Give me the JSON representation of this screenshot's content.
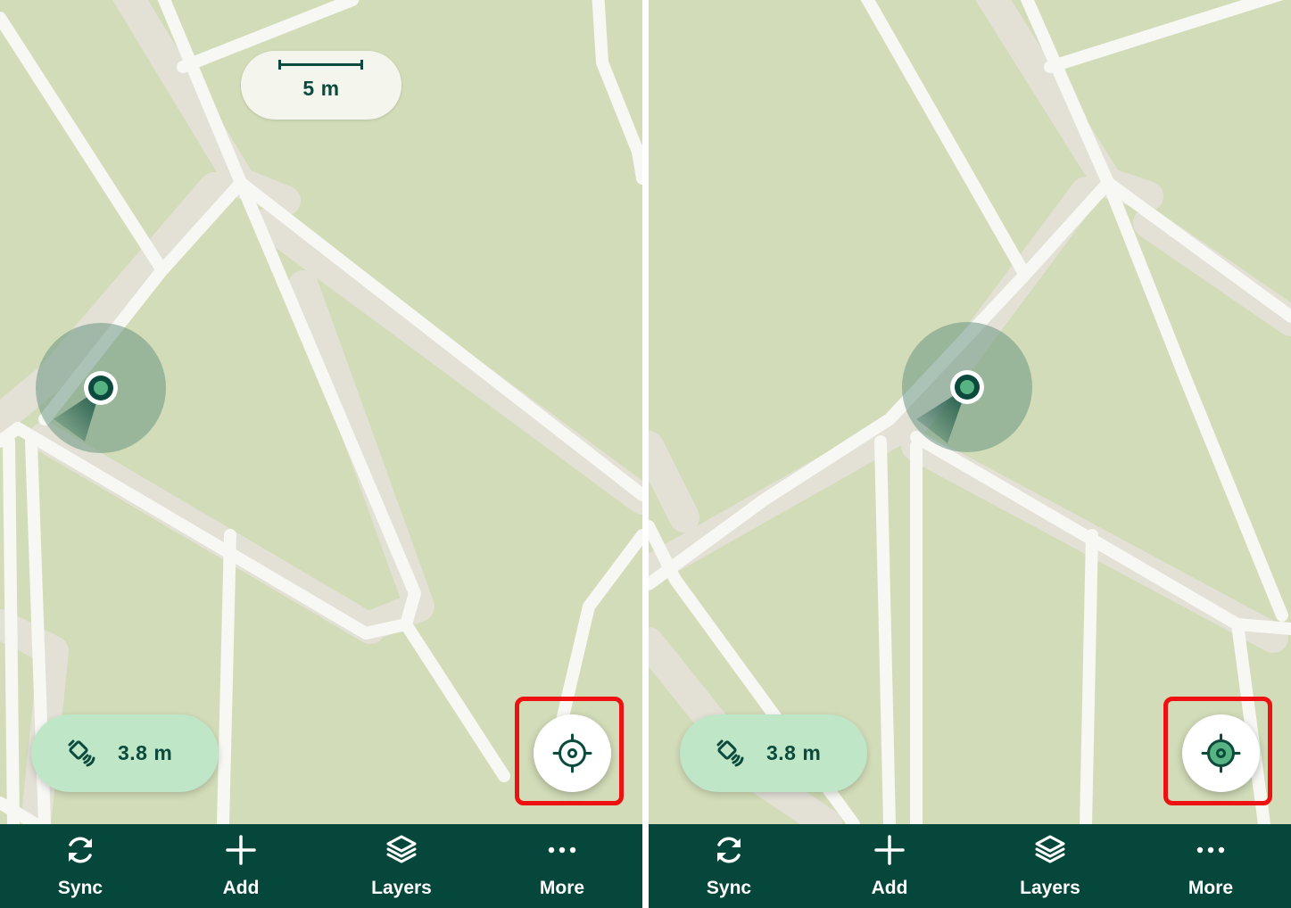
{
  "screens": [
    {
      "id": "left",
      "scale_label": "5 m",
      "accuracy_label": "3.8 m",
      "locate_button_state": "inactive",
      "locate_icon_color": "#0b4a3c",
      "locate_icon_fill": "#ffffff",
      "nav": [
        {
          "label": "Sync",
          "icon": "sync-icon"
        },
        {
          "label": "Add",
          "icon": "plus-icon"
        },
        {
          "label": "Layers",
          "icon": "layers-icon"
        },
        {
          "label": "More",
          "icon": "more-icon"
        }
      ]
    },
    {
      "id": "right",
      "accuracy_label": "3.8 m",
      "locate_button_state": "active",
      "locate_icon_color": "#0b4a3c",
      "locate_icon_fill": "#58b383",
      "nav": [
        {
          "label": "Sync",
          "icon": "sync-icon"
        },
        {
          "label": "Add",
          "icon": "plus-icon"
        },
        {
          "label": "Layers",
          "icon": "layers-icon"
        },
        {
          "label": "More",
          "icon": "more-icon"
        }
      ]
    }
  ],
  "colors": {
    "map_background": "#d2dcb8",
    "road": "#f7f7f3",
    "road_casing": "#e3e1d6",
    "nav_background": "#06473b",
    "accuracy_pill": "#c0e6c8",
    "highlight": "#ee1111",
    "location_dot": "#58b383"
  }
}
